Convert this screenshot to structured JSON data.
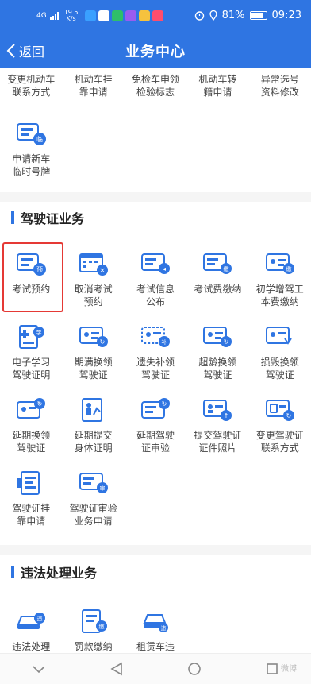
{
  "status_bar": {
    "signal": "4G",
    "speed": "19.5",
    "speed_unit": "K/s",
    "battery": "81%",
    "time": "09:23"
  },
  "nav": {
    "back_label": "返回",
    "title": "业务中心"
  },
  "vehicle_items": [
    {
      "label": "变更机动车\n联系方式"
    },
    {
      "label": "机动车挂\n靠申请"
    },
    {
      "label": "免检车申领\n检验标志"
    },
    {
      "label": "机动车转\n籍申请"
    },
    {
      "label": "异常选号\n资料修改"
    }
  ],
  "temp_plate": {
    "label": "申请新车\n临时号牌",
    "badge": "临"
  },
  "license_section": {
    "title": "驾驶证业务"
  },
  "license_items": [
    {
      "label": "考试预约",
      "badge": "预"
    },
    {
      "label": "取消考试\n预约",
      "badge": "×"
    },
    {
      "label": "考试信息\n公布",
      "badge": "◂"
    },
    {
      "label": "考试费缴纳",
      "badge": "缴"
    },
    {
      "label": "初学增驾工\n本费缴纳",
      "badge": "缴"
    },
    {
      "label": "电子学习\n驾驶证明",
      "badge": "学"
    },
    {
      "label": "期满换领\n驾驶证",
      "badge": "↻"
    },
    {
      "label": "遗失补领\n驾驶证",
      "badge": "补"
    },
    {
      "label": "超龄换领\n驾驶证",
      "badge": "↻"
    },
    {
      "label": "损毁换领\n驾驶证",
      "badge": ""
    },
    {
      "label": "延期换领\n驾驶证",
      "badge": "↻"
    },
    {
      "label": "延期提交\n身体证明",
      "badge": ""
    },
    {
      "label": "延期驾驶\n证审验",
      "badge": "↻"
    },
    {
      "label": "提交驾驶证\n证件照片",
      "badge": "↑"
    },
    {
      "label": "变更驾驶证\n联系方式",
      "badge": "↻"
    },
    {
      "label": "驾驶证挂\n靠申请",
      "badge": ""
    },
    {
      "label": "驾驶证审验\n业务申请",
      "badge": "审"
    }
  ],
  "violation_section": {
    "title": "违法处理业务"
  },
  "violation_items": [
    {
      "label": "违法处理",
      "badge": "违"
    },
    {
      "label": "罚款缴纳",
      "badge": "缴"
    },
    {
      "label": "租赁车违",
      "badge": "违"
    }
  ],
  "watermark": "微博",
  "colors": {
    "primary": "#2f75e2",
    "highlight": "#e53935"
  }
}
